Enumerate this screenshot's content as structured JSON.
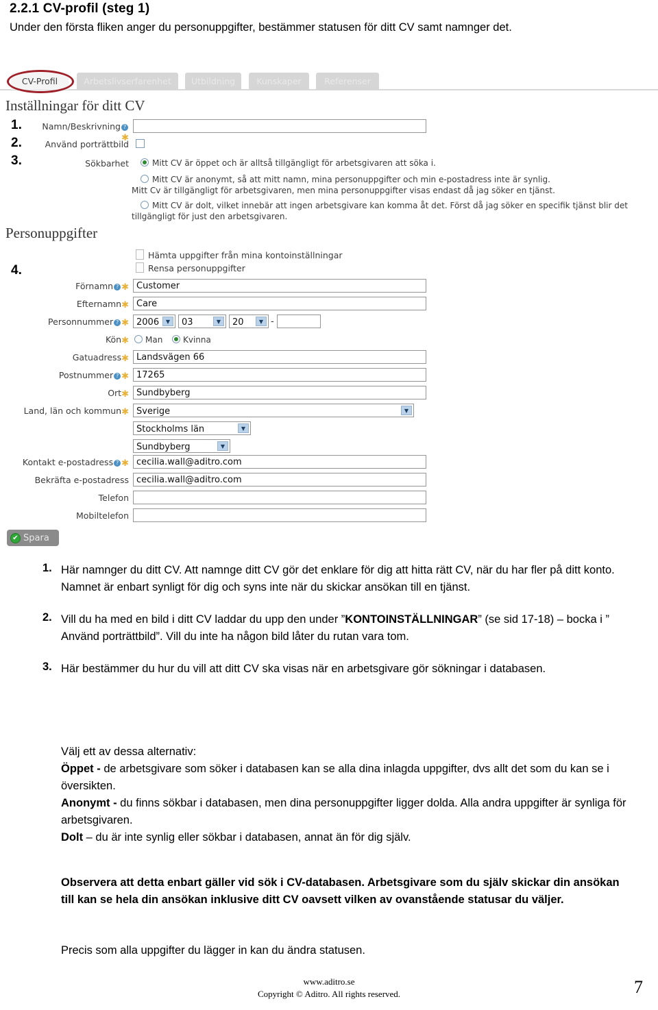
{
  "document": {
    "heading": "2.2.1 CV-profil (steg 1)",
    "intro": "Under den första fliken anger du personuppgifter, bestämmer statusen för ditt CV samt namnger det."
  },
  "screenshot": {
    "tabs": [
      {
        "label": "CV-Profil",
        "active": true
      },
      {
        "label": "Arbetslivserfarenhet",
        "active": false
      },
      {
        "label": "Utbildning",
        "active": false
      },
      {
        "label": "Kunskaper",
        "active": false
      },
      {
        "label": "Referenser",
        "active": false
      }
    ],
    "settings_section": {
      "title": "Inställningar för ditt CV",
      "markers": [
        "1.",
        "2.",
        "3.",
        "4."
      ],
      "name_label": "Namn/Beskrivning",
      "name_value": "",
      "portrait_label": "Använd porträttbild",
      "portrait_checked": false,
      "searchability_label": "Sökbarhet",
      "options": [
        {
          "selected": true,
          "lines": [
            "Mitt CV är öppet och är alltså tillgängligt för arbetsgivaren att söka i."
          ]
        },
        {
          "selected": false,
          "lines": [
            "Mitt CV är anonymt, så att mitt namn, mina personuppgifter och min e-postadress inte är synlig.",
            "Mitt Cv är tillgängligt för arbetsgivaren, men mina personuppgifter visas endast då jag söker en tjänst."
          ]
        },
        {
          "selected": false,
          "lines": [
            "Mitt CV är dolt, vilket innebär att ingen arbetsgivare kan komma åt det. Först då jag söker en specifik tjänst blir det",
            "tillgängligt för just den arbetsgivaren."
          ]
        }
      ]
    },
    "personal_section": {
      "title": "Personuppgifter",
      "actions": [
        "Hämta uppgifter från mina kontoinställningar",
        "Rensa personuppgifter"
      ],
      "fields": {
        "firstname_label": "Förnamn",
        "firstname_value": "Customer",
        "lastname_label": "Efternamn",
        "lastname_value": "Care",
        "ssn_label": "Personnummer",
        "ssn_year": "2006",
        "ssn_month": "03",
        "ssn_day": "20",
        "ssn_dash": "-",
        "ssn_last": "",
        "gender_label": "Kön",
        "gender_male": "Man",
        "gender_female": "Kvinna",
        "gender_selected": "Kvinna",
        "street_label": "Gatuadress",
        "street_value": "Landsvägen 66",
        "zip_label": "Postnummer",
        "zip_value": "17265",
        "city_label": "Ort",
        "city_value": "Sundbyberg",
        "region_label": "Land, län och kommun",
        "country_value": "Sverige",
        "county_value": "Stockholms län",
        "municipality_value": "Sundbyberg",
        "email_label": "Kontakt e-postadress",
        "email_value": "cecilia.wall@aditro.com",
        "email_confirm_label": "Bekräfta e-postadress",
        "email_confirm_value": "cecilia.wall@aditro.com",
        "phone_label": "Telefon",
        "phone_value": "",
        "mobile_label": "Mobiltelefon",
        "mobile_value": ""
      },
      "save_button": "Spara",
      "save_icon": "check-circle-icon"
    }
  },
  "explanations": [
    {
      "num": "1.",
      "text": "Här namnger du ditt CV. Att namnge ditt CV gör det enklare för dig att hitta rätt CV, när du har fler på ditt konto. Namnet är enbart synligt för dig och syns inte när du skickar ansökan till en tjänst."
    },
    {
      "num": "2.",
      "text_before": "Vill du ha med en bild i ditt CV laddar du upp den under ”",
      "bold": "KONTOINSTÄLLNINGAR",
      "text_after": "” (se sid 17-18) – bocka i ” Använd porträttbild”. Vill du inte ha någon bild låter du rutan vara tom."
    },
    {
      "num": "3.",
      "text": "Här bestämmer du hur du vill att ditt CV ska visas när en arbetsgivare gör sökningar i databasen."
    }
  ],
  "options_explanation": {
    "intro": "Välj ett av dessa alternativ:",
    "items": [
      {
        "term": "Öppet - ",
        "desc": "de arbetsgivare som söker i databasen kan se alla dina inlagda uppgifter, dvs allt det som du kan se i översikten."
      },
      {
        "term": "Anonymt - ",
        "desc": "du finns sökbar i databasen, men dina personuppgifter ligger dolda. Alla andra uppgifter är synliga för arbetsgivaren."
      },
      {
        "term": "Dolt ",
        "desc": "– du är inte synlig eller sökbar i databasen, annat än för dig själv."
      }
    ],
    "note": "Observera att detta enbart gäller vid sök i CV-databasen. Arbetsgivare som du själv skickar din ansökan till kan se hela din ansökan inklusive ditt CV oavsett vilken av ovanstående statusar du väljer.",
    "closing": "Precis som alla uppgifter du lägger in kan du ändra statusen."
  },
  "footer": {
    "site": "www.aditro.se",
    "copyright": "Copyright © Aditro. All rights reserved.",
    "page_number": "7"
  }
}
